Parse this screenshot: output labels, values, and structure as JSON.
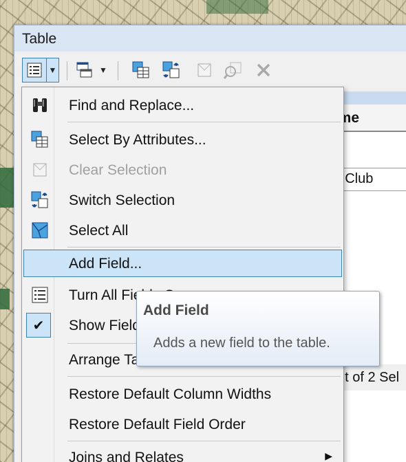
{
  "window": {
    "title": "Table"
  },
  "table": {
    "column_header": "ame",
    "cell_value": "ry Club",
    "status_text": "ut of 2 Sel"
  },
  "menu": {
    "items": [
      {
        "label": "Find and Replace...",
        "icon": "binoculars-icon",
        "enabled": true
      },
      {
        "label": "Select By Attributes...",
        "icon": "select-by-attributes-icon",
        "enabled": true
      },
      {
        "label": "Clear Selection",
        "icon": "clear-selection-icon",
        "enabled": false
      },
      {
        "label": "Switch Selection",
        "icon": "switch-selection-icon",
        "enabled": true
      },
      {
        "label": "Select All",
        "icon": "select-all-icon",
        "enabled": true
      },
      {
        "label": "Add Field...",
        "icon": "",
        "enabled": true,
        "hovered": true
      },
      {
        "label": "Turn All Fields On",
        "icon": "field-list-icon",
        "enabled": true
      },
      {
        "label": "Show Field Aliases",
        "icon": "checkmark-icon",
        "enabled": true,
        "checked": true
      },
      {
        "label": "Arrange Tables",
        "icon": "",
        "enabled": true
      },
      {
        "label": "Restore Default Column Widths",
        "icon": "",
        "enabled": true
      },
      {
        "label": "Restore Default Field Order",
        "icon": "",
        "enabled": true
      },
      {
        "label": "Joins and Relates",
        "icon": "",
        "enabled": true,
        "submenu": true
      }
    ]
  },
  "tooltip": {
    "title": "Add Field",
    "body": "Adds a new field to the table."
  },
  "colors": {
    "hover_bg": "#cce4f7",
    "hover_border": "#3c7fb1",
    "menu_bg": "#f2f2f2",
    "titlebar_bg": "#dbe6f4"
  }
}
